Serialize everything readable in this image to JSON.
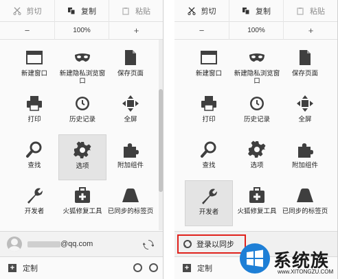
{
  "edit": {
    "cut": "剪切",
    "copy": "复制",
    "paste": "粘贴"
  },
  "zoom": {
    "minus": "−",
    "value": "100%",
    "plus": "+"
  },
  "items": [
    {
      "label": "新建窗口",
      "icon": "new-window-icon"
    },
    {
      "label": "新建隐私浏览窗口",
      "icon": "private-mask-icon"
    },
    {
      "label": "保存页面",
      "icon": "save-page-icon"
    },
    {
      "label": "打印",
      "icon": "printer-icon"
    },
    {
      "label": "历史记录",
      "icon": "clock-icon"
    },
    {
      "label": "全屏",
      "icon": "fullscreen-icon"
    },
    {
      "label": "查找",
      "icon": "magnifier-icon"
    },
    {
      "label": "选项",
      "icon": "gear-icon"
    },
    {
      "label": "附加组件",
      "icon": "puzzle-icon"
    },
    {
      "label": "开发者",
      "icon": "wrench-icon"
    },
    {
      "label": "火狐修复工具",
      "icon": "toolkit-icon"
    },
    {
      "label": "已同步的标签页",
      "icon": "synced-tabs-icon"
    }
  ],
  "left": {
    "active_index": 7,
    "account_email": "@qq.com"
  },
  "right": {
    "active_index": 9,
    "signin_label": "登录以同步"
  },
  "bottom": {
    "customize": "定制"
  },
  "watermark": {
    "brand": "系统族",
    "site": "www.XITONGZU.COM"
  },
  "colors": {
    "highlight_border": "#e0201b",
    "icon_gray": "#3f3f3f"
  }
}
